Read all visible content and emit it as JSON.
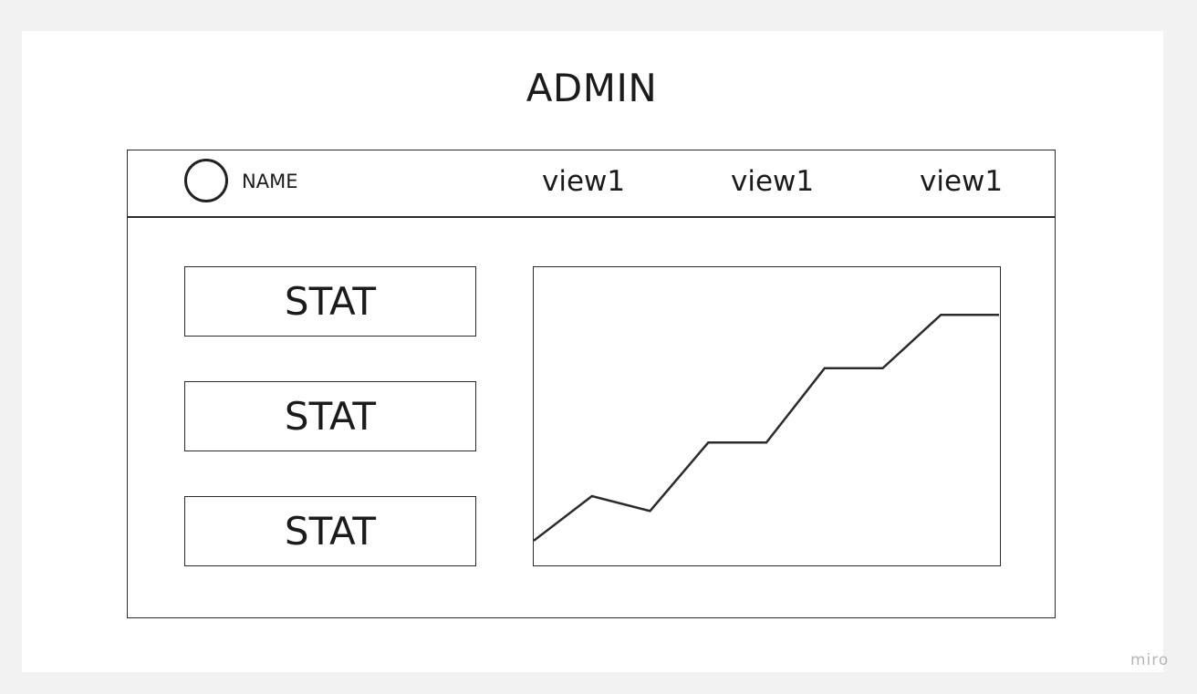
{
  "page": {
    "title": "ADMIN"
  },
  "header": {
    "user_name": "NAME",
    "nav": [
      "view1",
      "view1",
      "view1"
    ]
  },
  "stats": [
    {
      "label": "STAT"
    },
    {
      "label": "STAT"
    },
    {
      "label": "STAT"
    }
  ],
  "chart_data": {
    "type": "line",
    "x": [
      0,
      1,
      2,
      3,
      4,
      5,
      6,
      7,
      8
    ],
    "series": [
      {
        "values": [
          0.8,
          2.3,
          1.8,
          4.1,
          4.1,
          6.6,
          6.6,
          8.4,
          8.4
        ]
      }
    ],
    "xlim": [
      0,
      8
    ],
    "ylim": [
      0,
      10
    ],
    "grid": false,
    "color": "#2b2b2b"
  },
  "watermark": "miro"
}
